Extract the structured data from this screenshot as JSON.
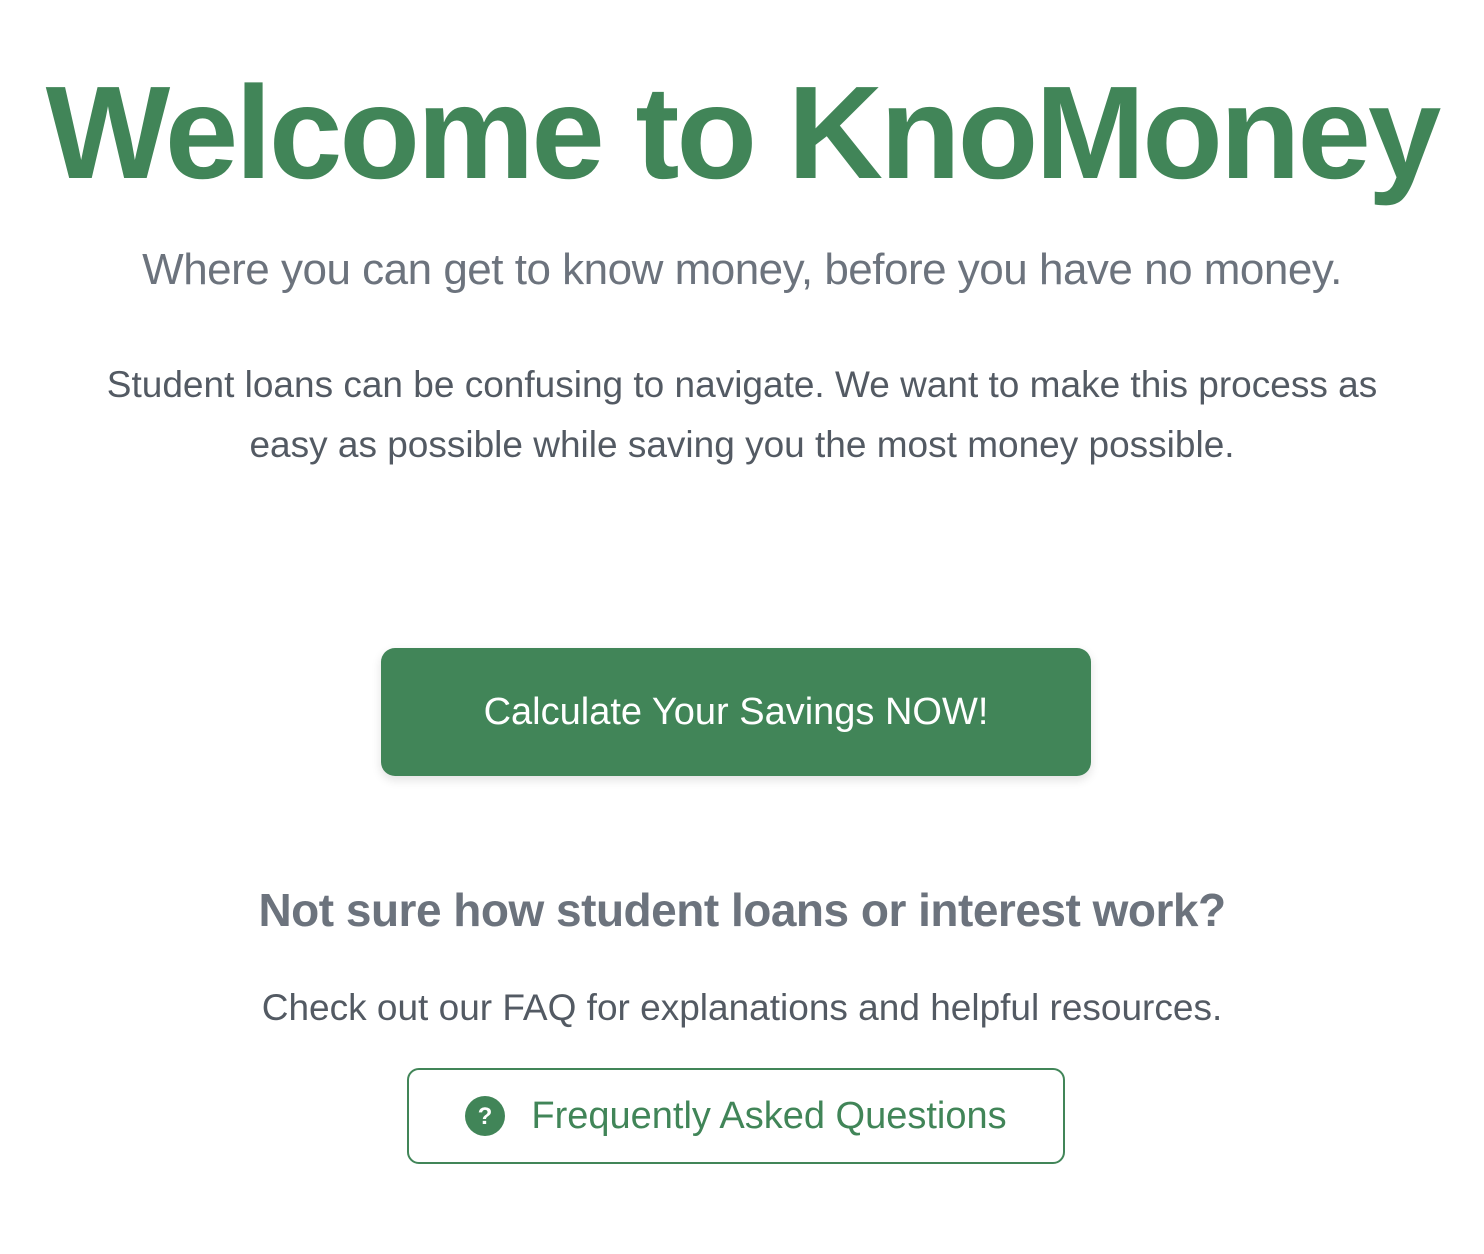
{
  "hero": {
    "title": "Welcome to KnoMoney",
    "subtitle": "Where you can get to know money, before you have no money.",
    "intro": "Student loans can be confusing to navigate. We want to make this process as easy as possible while saving you the most money possible."
  },
  "cta": {
    "label": "Calculate Your Savings NOW!"
  },
  "faq": {
    "heading": "Not sure how student loans or interest work?",
    "text": "Check out our FAQ for explanations and helpful resources.",
    "button_label": "Frequently Asked Questions",
    "button_icon": "question-circle-icon"
  },
  "colors": {
    "brand_green": "#418558",
    "muted_gray": "#6c737d",
    "body_text": "#535a63"
  }
}
